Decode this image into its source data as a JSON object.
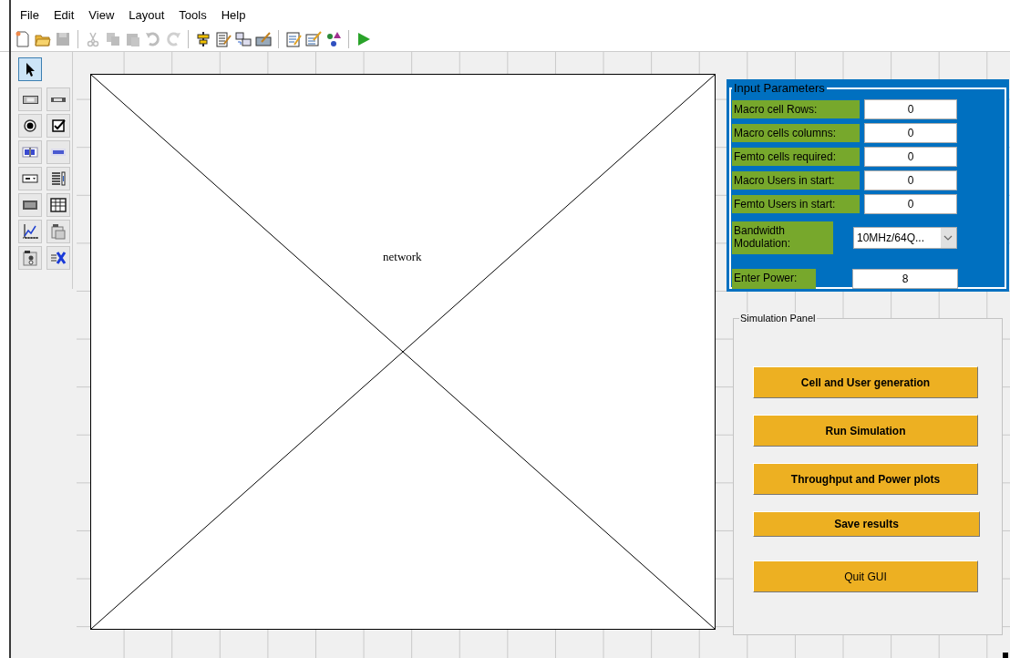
{
  "menu": [
    "File",
    "Edit",
    "View",
    "Layout",
    "Tools",
    "Help"
  ],
  "toolbar": [
    {
      "kind": "new",
      "disabled": false
    },
    {
      "kind": "open",
      "disabled": false
    },
    {
      "kind": "save",
      "disabled": true
    },
    {
      "kind": "separator"
    },
    {
      "kind": "cut",
      "disabled": true
    },
    {
      "kind": "copy",
      "disabled": true
    },
    {
      "kind": "paste",
      "disabled": true
    },
    {
      "kind": "undo",
      "disabled": true
    },
    {
      "kind": "redo",
      "disabled": true
    },
    {
      "kind": "separator"
    },
    {
      "kind": "align",
      "disabled": false
    },
    {
      "kind": "menu-editor",
      "disabled": false
    },
    {
      "kind": "tab-order",
      "disabled": false
    },
    {
      "kind": "toolbar-editor",
      "disabled": false
    },
    {
      "kind": "separator"
    },
    {
      "kind": "editor",
      "disabled": false
    },
    {
      "kind": "inspector",
      "disabled": false
    },
    {
      "kind": "browser",
      "disabled": false
    },
    {
      "kind": "separator"
    },
    {
      "kind": "run",
      "disabled": false
    }
  ],
  "palette": [
    {
      "kind": "pointer",
      "selected": true
    },
    {
      "kind": "push-button",
      "selected": false
    },
    {
      "kind": "slider",
      "selected": false
    },
    {
      "kind": "radio",
      "selected": false
    },
    {
      "kind": "checkbox",
      "selected": false
    },
    {
      "kind": "edit-text",
      "selected": false
    },
    {
      "kind": "static-text",
      "selected": false
    },
    {
      "kind": "popup",
      "selected": false
    },
    {
      "kind": "listbox",
      "selected": false
    },
    {
      "kind": "toggle",
      "selected": false
    },
    {
      "kind": "table",
      "selected": false
    },
    {
      "kind": "axes",
      "selected": false
    },
    {
      "kind": "panel",
      "selected": false
    },
    {
      "kind": "button-group",
      "selected": false
    },
    {
      "kind": "activex",
      "selected": false
    }
  ],
  "axes": {
    "label": "network"
  },
  "input_panel": {
    "title": "Input Parameters",
    "rows": [
      {
        "kind": "edit",
        "label": "Macro cell Rows:",
        "value": "0"
      },
      {
        "kind": "edit",
        "label": "Macro  cells columns:",
        "value": "0"
      },
      {
        "kind": "edit",
        "label": "Femto cells required:",
        "value": "0"
      },
      {
        "kind": "edit",
        "label": "Macro Users in start:",
        "value": "0"
      },
      {
        "kind": "edit",
        "label": "Femto Users in start:",
        "value": "0"
      },
      {
        "kind": "popup",
        "label": "Bandwidth Modulation:",
        "value": "10MHz/64Q..."
      },
      {
        "kind": "power",
        "label": "Enter Power:",
        "value": "8"
      }
    ]
  },
  "simulation_panel": {
    "title": "Simulation Panel",
    "buttons": [
      {
        "label": "Cell and User generation",
        "bold": true
      },
      {
        "label": "Run Simulation",
        "bold": true
      },
      {
        "label": "Throughput and Power plots",
        "bold": true
      },
      {
        "label": "Save results",
        "bold": true,
        "kind": "short"
      },
      {
        "label": "Quit GUI",
        "bold": false
      }
    ]
  }
}
